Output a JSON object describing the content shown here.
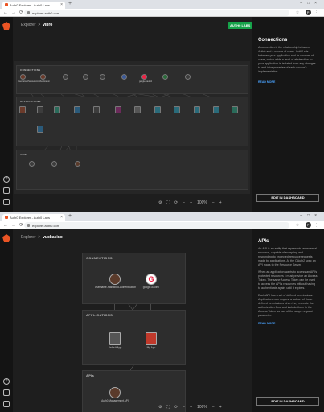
{
  "w1": {
    "tab_title": "Auth0 Explorer - Auth0 Labs",
    "url": "explorer.auth0.com",
    "crumb_root": "Explorer",
    "crumb_sep": ">",
    "crumb_tenant": "vibro",
    "labs_label": "AUTH0 LABS",
    "connections_label": "CONNECTIONS",
    "applications_label": "APPLICATIONS",
    "apis_label": "APIS",
    "connections": [
      "Username-Password-Authentication",
      "google-oauth2",
      "",
      "",
      "",
      "",
      "",
      "",
      ""
    ],
    "applications": [
      "",
      "",
      "",
      "",
      "",
      "",
      "",
      "",
      "",
      "",
      "",
      "",
      ""
    ],
    "apis": [
      "",
      "",
      ""
    ],
    "panel_title": "Connections",
    "panel_text": "A connection is the relationship between Auth0 and a source of users. Auth0 sits between your application and its sources of users, which adds a level of abstraction so your application is isolated from any changes to and idiosyncrasies of each source's implementation.",
    "read_more": "READ MORE",
    "edit_button": "EDIT IN DASHBOARD",
    "zoom": "100%"
  },
  "w2": {
    "tab_title": "Auth0 Explorer - Auth0 Labs",
    "url": "explorer.auth0.com",
    "crumb_root": "Explorer",
    "crumb_sep": ">",
    "crumb_tenant": "vucbasino",
    "connections_label": "CONNECTIONS",
    "applications_label": "APPLICATIONS",
    "apis_label": "APIs",
    "conn1": "Username-Password-Authentication",
    "conn2": "google-oauth2",
    "app1": "Default App",
    "app2": "My App",
    "api1": "Auth0 Management API",
    "panel_title": "APIs",
    "panel_p1": "An API is an entity that represents an external resource, capable of accepting and responding to protected resource requests made by applications. At the OAuth2 spec an API maps to the Resource Server.",
    "panel_p2": "When an application wants to access an API's protected resources it must provide an Access Token. The same Access Token can be used to access the API's resources without having to authenticate again, until it expires.",
    "panel_p3": "Each API has a set of defined permissions. Applications can request a subset of those defined permissions when they execute the authorization flow, and include them in the Access Token as part of the scope request parameter.",
    "read_more": "READ MORE",
    "edit_button": "EDIT IN DASHBOARD",
    "zoom": "100%"
  },
  "colors": {
    "brand": "#eb5424",
    "labs": "#16a34a",
    "link": "#4aa3ff"
  }
}
